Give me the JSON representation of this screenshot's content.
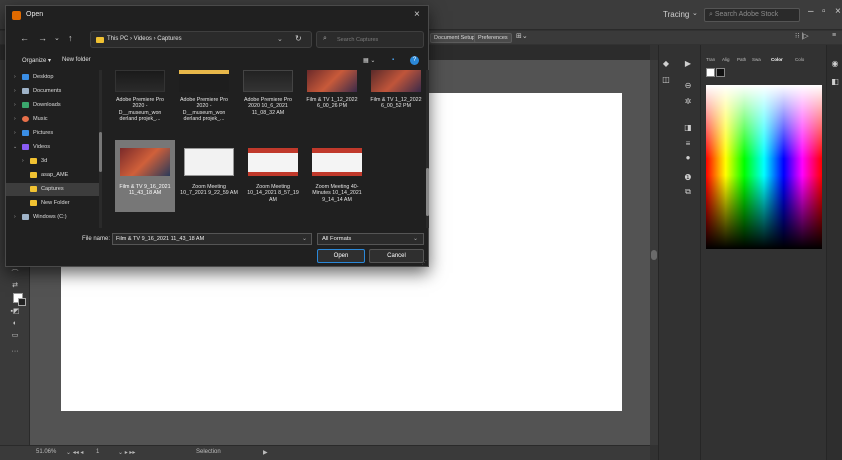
{
  "illustrator": {
    "tracing_label": "Tracing",
    "search_stock_placeholder": "Search Adobe Stock",
    "controlbar": {
      "document_setup": "Document Setup",
      "preferences": "Preferences"
    },
    "statusbar": {
      "zoom": "51.06%",
      "page": "1",
      "mode": "Selection"
    },
    "color_panel_tabs": [
      "Tran",
      "Alig",
      "Path",
      "Swa",
      "Color",
      "Colo"
    ],
    "color_panel_active_tab": "Color"
  },
  "dialog": {
    "title": "Open",
    "address_path": "This PC  ›  Videos  ›  Captures",
    "search_placeholder": "Search Captures",
    "organize_label": "Organize ▾",
    "new_folder_label": "New folder",
    "nav_items": [
      {
        "label": "Desktop",
        "color": "#3a8ee6"
      },
      {
        "label": "Documents",
        "color": "#9fb3c8"
      },
      {
        "label": "Downloads",
        "color": "#3aa76d"
      },
      {
        "label": "Music",
        "color": "#e8704a"
      },
      {
        "label": "Pictures",
        "color": "#3a8ee6"
      },
      {
        "label": "Videos",
        "color": "#8a5cf5"
      },
      {
        "label": "3d",
        "color": "#f1c232"
      },
      {
        "label": "asap_AME",
        "color": "#f1c232"
      },
      {
        "label": "Captures",
        "color": "#f1c232"
      },
      {
        "label": "New Folder",
        "color": "#f1c232"
      },
      {
        "label": "Windows (C:)",
        "color": "#9fb3c8"
      }
    ],
    "files_row1": [
      "Adobe Premiere Pro 2020 - D__museum_won derland projek_...",
      "Adobe Premiere Pro 2020 - D__museum_won derland projek_...",
      "Adobe Premiere Pro 2020 10_6_2021 11_08_32 AM",
      "Film & TV 1_12_2022 6_00_26 PM",
      "Film & TV 1_12_2022 6_00_52 PM"
    ],
    "files_row2": [
      "Film & TV 9_16_2021 11_43_18 AM",
      "Zoom Meeting 10_7_2021 9_22_59 AM",
      "Zoom Meeting 10_14_2021 8_57_19 AM",
      "Zoom Meeting 40-Minutes 10_14_2021 9_14_14 AM"
    ],
    "file_name_label": "File name:",
    "file_name_value": "Film & TV 9_16_2021 11_43_18 AM",
    "format_value": "All Formats",
    "open_label": "Open",
    "cancel_label": "Cancel"
  }
}
